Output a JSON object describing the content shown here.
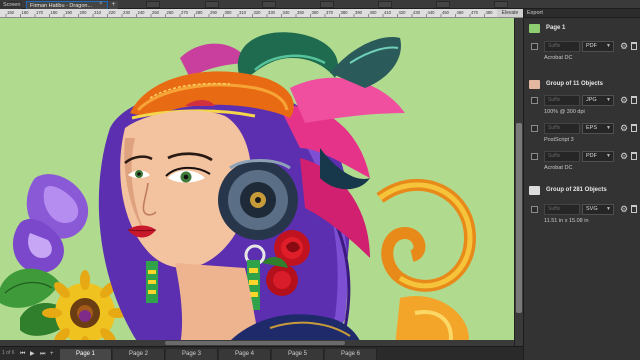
{
  "tabs": {
    "screen": "Screen",
    "file": "Firman Hatibu - Dragon...",
    "close": "×",
    "add": "+"
  },
  "ruler": {
    "ticks": [
      "150",
      "160",
      "170",
      "180",
      "190",
      "200",
      "210",
      "220",
      "230",
      "240",
      "250",
      "260",
      "270",
      "280",
      "290",
      "300",
      "310",
      "320",
      "330",
      "340",
      "350",
      "360",
      "370",
      "380",
      "390",
      "400",
      "410",
      "420",
      "430",
      "440",
      "450",
      "460",
      "470",
      "480"
    ],
    "label": "Elevate"
  },
  "export": {
    "title": "Export",
    "page1": {
      "name": "Page 1",
      "rows": [
        {
          "suffix": "Suffix",
          "format": "PDF",
          "desc": "Acrobat DC"
        }
      ]
    },
    "group11": {
      "name": "Group of 11 Objects",
      "rows": [
        {
          "suffix": "Suffix",
          "format": "JPG",
          "desc": "100% @ 300 dpi"
        },
        {
          "suffix": "Suffix",
          "format": "EPS",
          "desc": "PostScript 3"
        },
        {
          "suffix": "Suffix",
          "format": "PDF",
          "desc": "Acrobat DC"
        }
      ]
    },
    "group281": {
      "name": "Group of 281 Objects",
      "rows": [
        {
          "suffix": "Suffix",
          "format": "SVG",
          "desc": "11.51 in x 15.08 in"
        }
      ]
    }
  },
  "pagebar": {
    "counter": "1 of 6",
    "pages": [
      "Page 1",
      "Page 2",
      "Page 3",
      "Page 4",
      "Page 5",
      "Page 6"
    ],
    "active": "Page 1"
  },
  "icons": {
    "gear": "gear-icon",
    "trash": "trash-icon",
    "dropdown": "chevron-down-icon",
    "first": "first-page-icon",
    "prev": "prev-page-icon",
    "next": "next-page-icon",
    "last": "last-page-icon"
  },
  "colors": {
    "canvas": "#b0db8e",
    "accent": "#1f6db8",
    "panel": "#333333"
  }
}
